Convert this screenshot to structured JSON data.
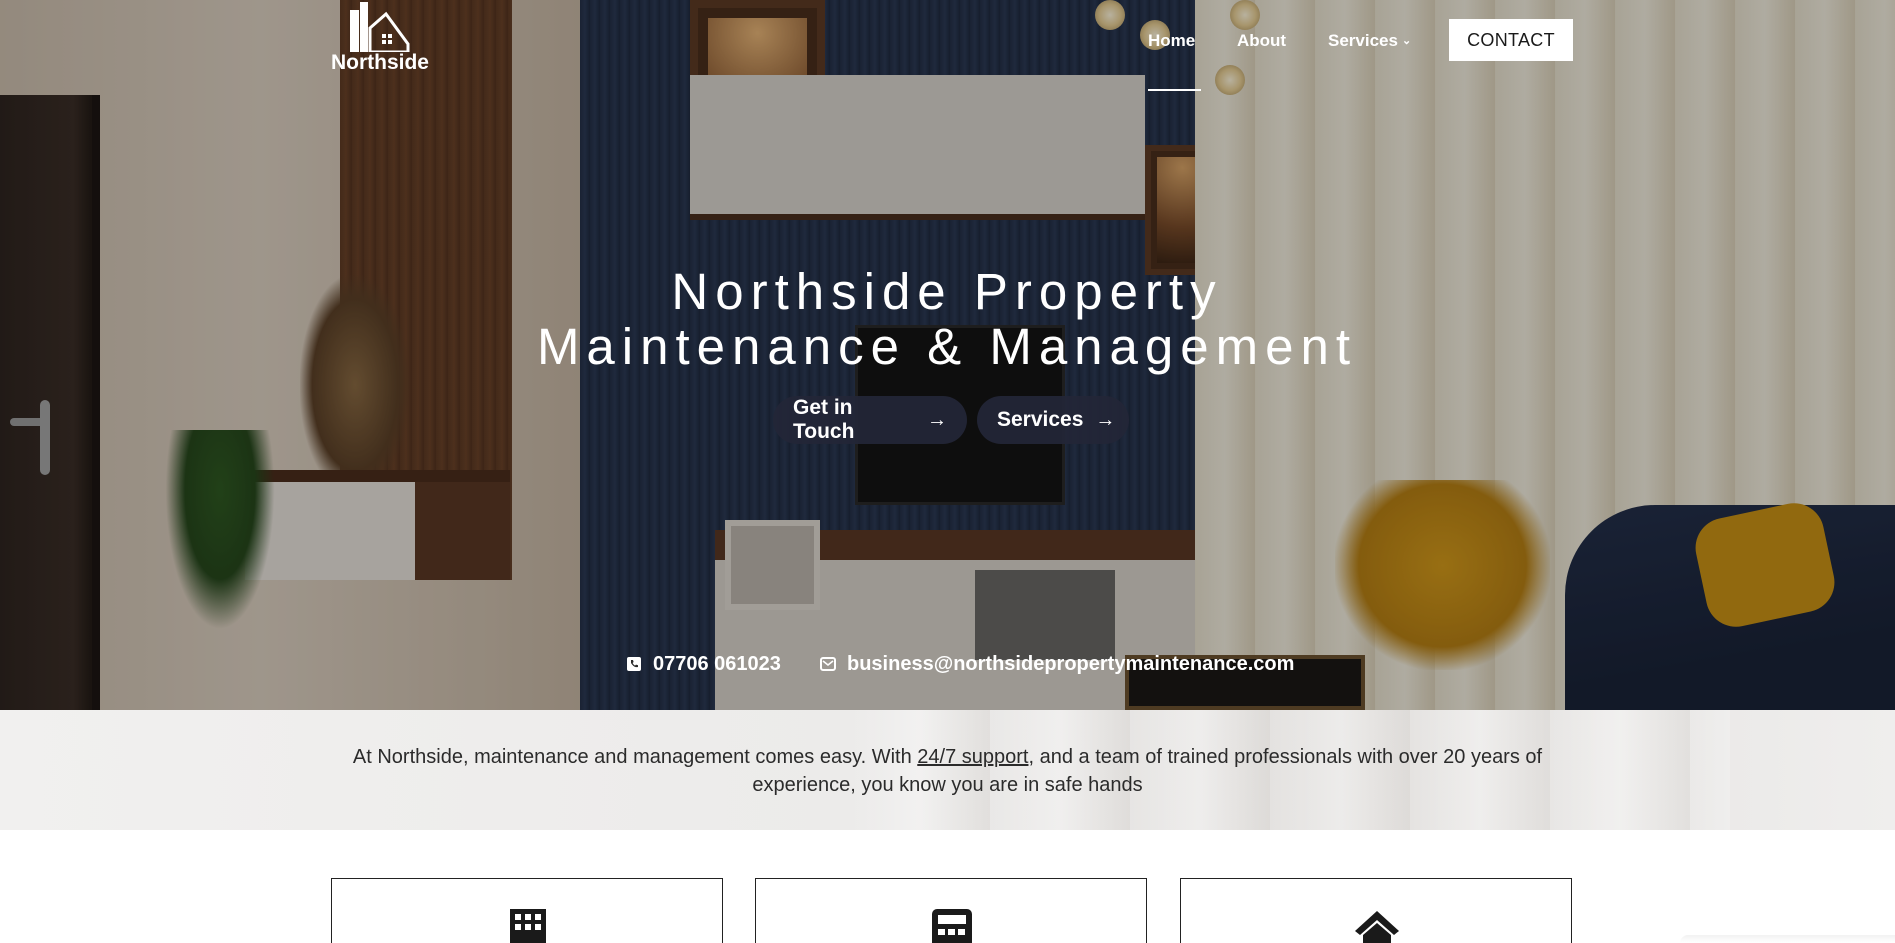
{
  "brand": {
    "name": "Northside"
  },
  "nav": {
    "items": [
      {
        "label": "Home",
        "active": true
      },
      {
        "label": "About"
      },
      {
        "label": "Services"
      }
    ],
    "contact_button": "CONTACT"
  },
  "hero": {
    "title_line1": "Northside Property",
    "title_line2": "Maintenance & Management",
    "buttons": [
      {
        "label": "Get in Touch",
        "icon": "arrow-right-icon"
      },
      {
        "label": "Services",
        "icon": "arrow-right-icon"
      }
    ],
    "phone": "07706 061023",
    "email": "business@northsidepropertymaintenance.com"
  },
  "intro": {
    "text_before": "At Northside, maintenance and management comes easy. With ",
    "link": "24/7 support",
    "text_after": ", and a team of trained professionals with over 20 years of experience, you know you are in safe hands"
  },
  "cards": [
    {
      "icon": "building-icon"
    },
    {
      "icon": "calculator-icon"
    },
    {
      "icon": "house-icon"
    }
  ],
  "colors": {
    "pill_bg": "#23263a",
    "text_dark": "#2b2b2b",
    "white": "#ffffff"
  }
}
